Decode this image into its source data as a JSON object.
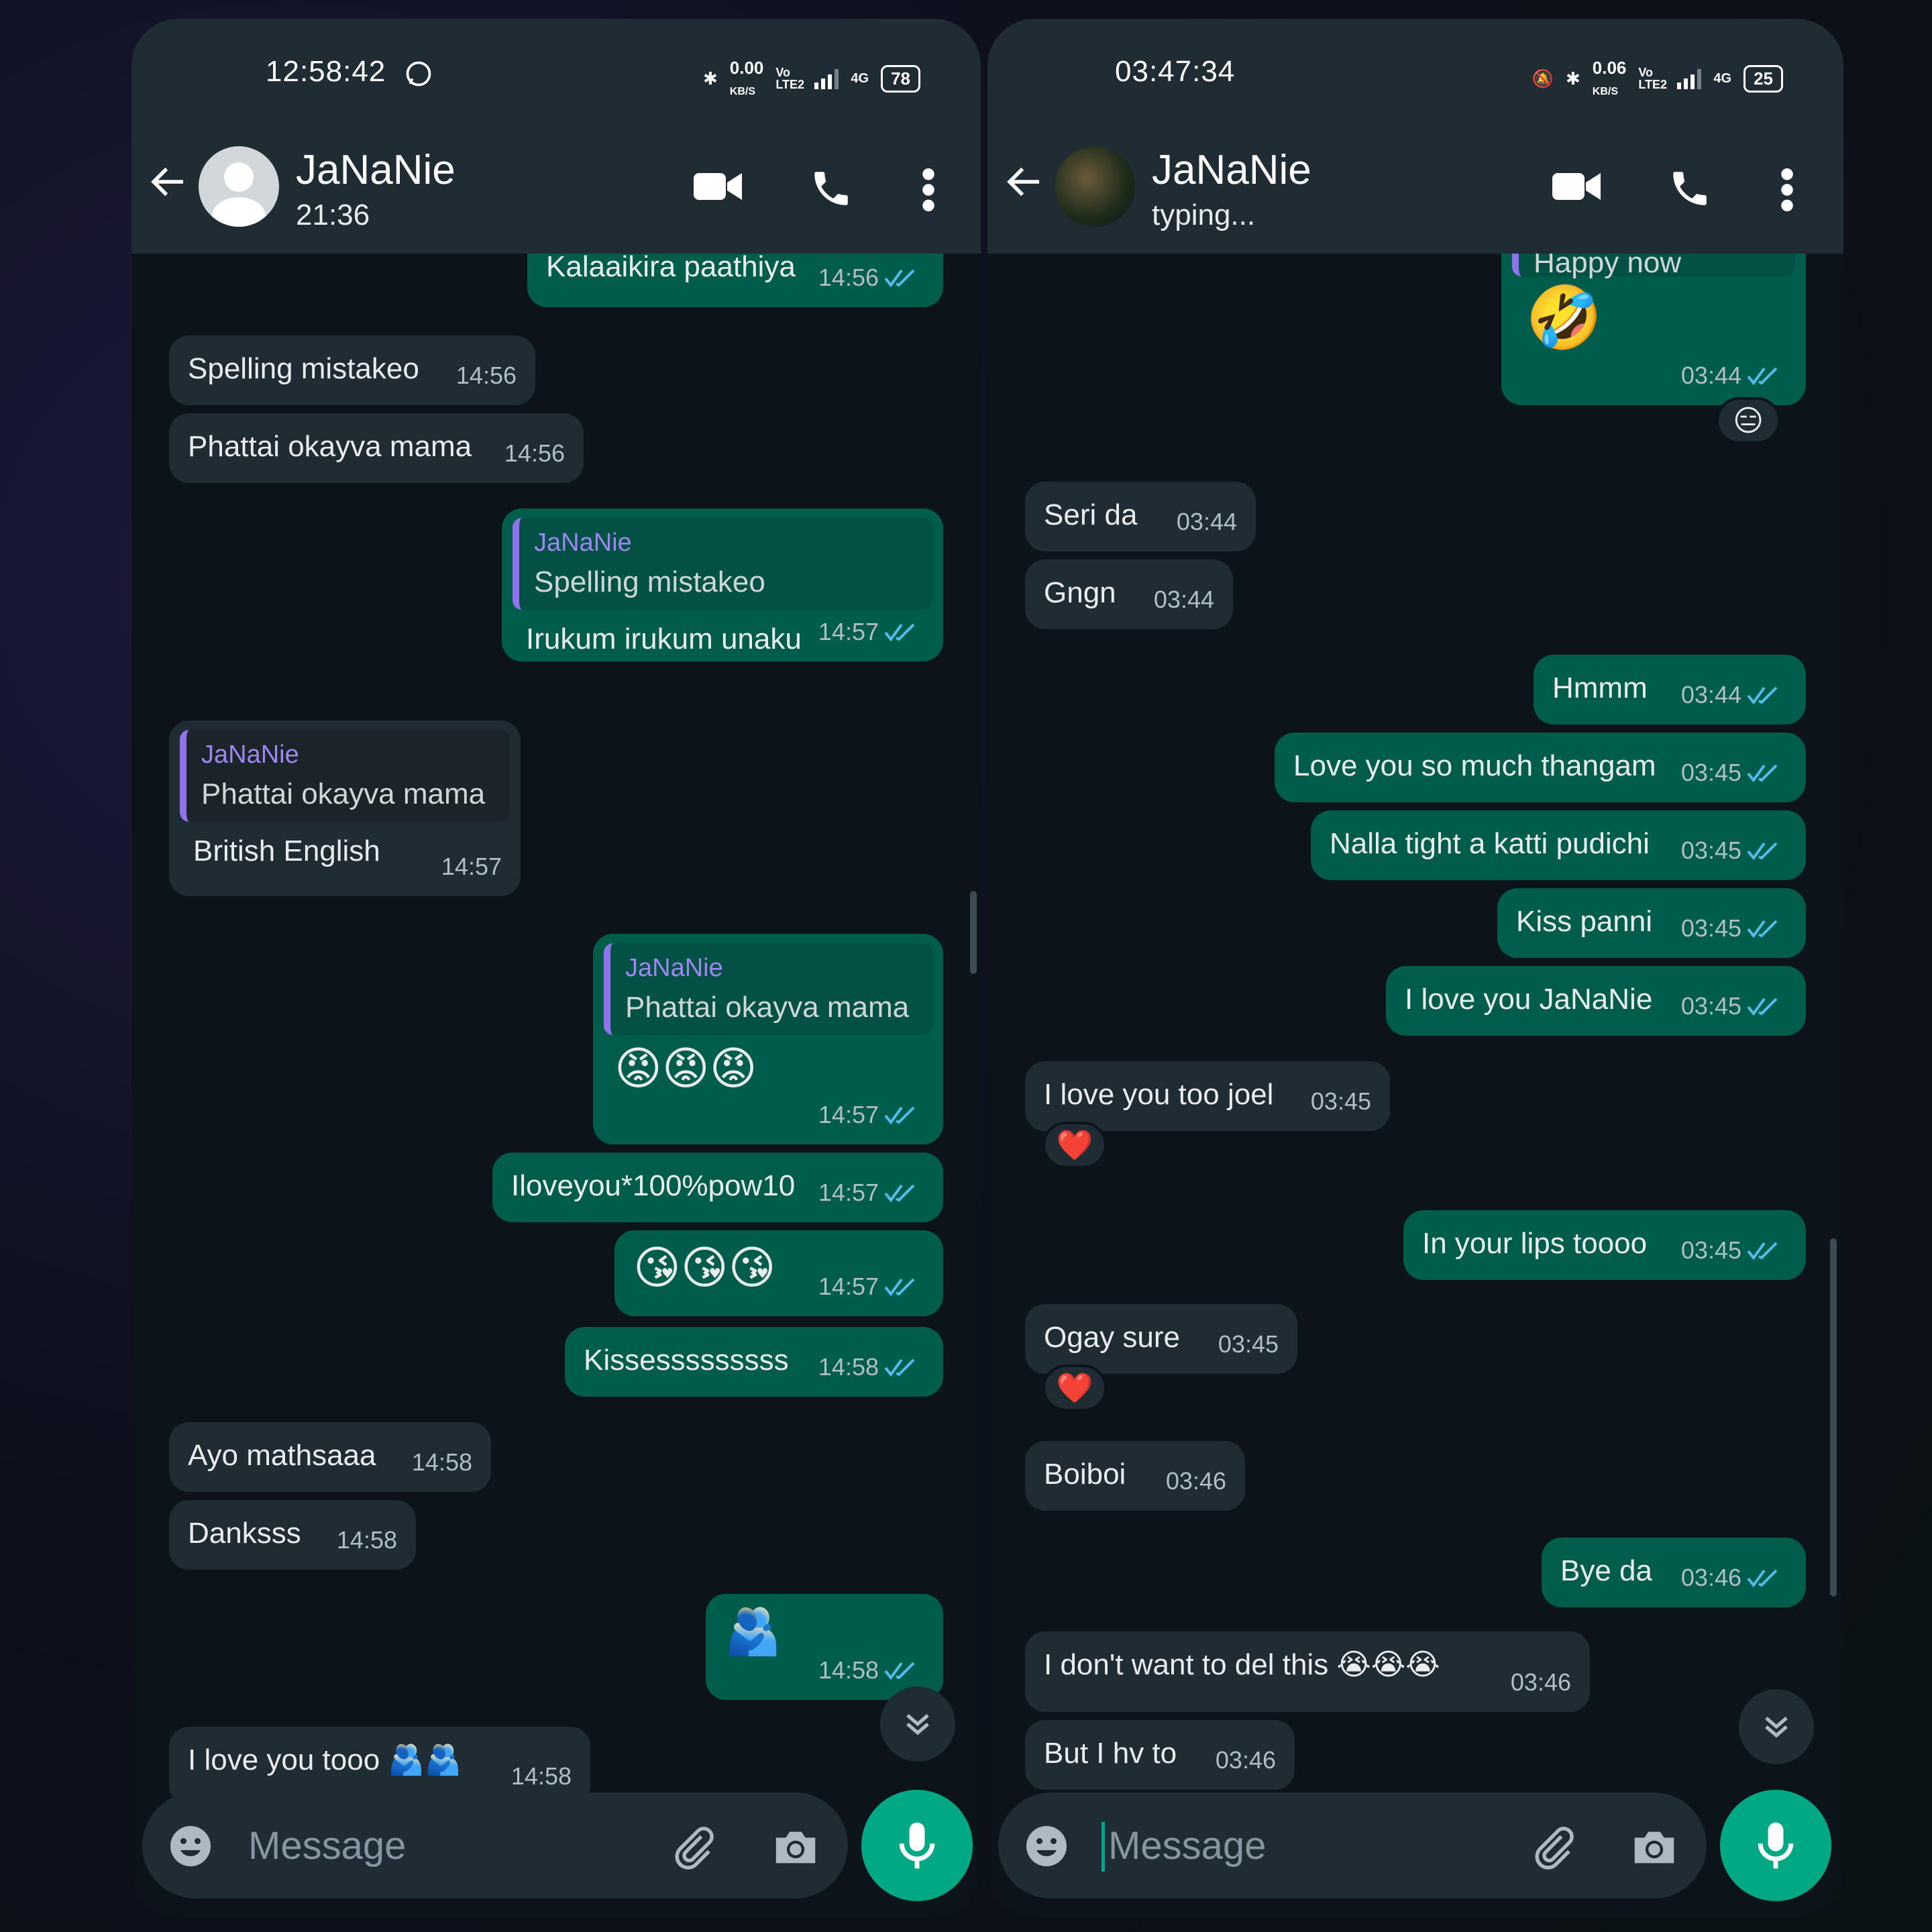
{
  "left": {
    "status": {
      "time": "12:58:42",
      "net_speed": "0.00",
      "net_unit": "KB/S",
      "volte": "Vo LTE2",
      "network": "4G",
      "battery": "78"
    },
    "header": {
      "name": "JaNaNie",
      "status": "21:36"
    },
    "messages": [
      {
        "text": "Kalaaikira paathiya",
        "time": "14:56"
      },
      {
        "text": "Spelling mistakeo",
        "time": "14:56"
      },
      {
        "text": "Phattai okayva mama",
        "time": "14:56"
      },
      {
        "quote_name": "JaNaNie",
        "quote_text": "Spelling mistakeo",
        "text": "Irukum irukum unaku",
        "time": "14:57"
      },
      {
        "quote_name": "JaNaNie",
        "quote_text": "Phattai okayva mama",
        "text": "British English",
        "time": "14:57"
      },
      {
        "quote_name": "JaNaNie",
        "quote_text": "Phattai okayva mama",
        "text": "😡😡😡",
        "time": "14:57"
      },
      {
        "text": "Iloveyou*100%pow10",
        "time": "14:57"
      },
      {
        "text": "😘😘😘",
        "time": "14:57"
      },
      {
        "text": "Kissesssssssss",
        "time": "14:58"
      },
      {
        "text": "Ayo mathsaaa",
        "time": "14:58"
      },
      {
        "text": "Danksss",
        "time": "14:58"
      },
      {
        "text": "🫂",
        "time": "14:58"
      },
      {
        "text": "I love you tooo 🫂🫂",
        "time": "14:58"
      }
    ],
    "composer": {
      "placeholder": "Message"
    }
  },
  "right": {
    "status": {
      "time": "03:47:34",
      "net_speed": "0.06",
      "net_unit": "KB/S",
      "volte": "Vo LTE2",
      "network": "4G",
      "battery": "25"
    },
    "header": {
      "name": "JaNaNie",
      "status": "typing..."
    },
    "messages": [
      {
        "quote_text": "Happy now",
        "text": "🤣",
        "time": "03:44",
        "reaction": "😑"
      },
      {
        "text": "Seri da",
        "time": "03:44"
      },
      {
        "text": "Gngn",
        "time": "03:44"
      },
      {
        "text": "Hmmm",
        "time": "03:44"
      },
      {
        "text": "Love you so much thangam",
        "time": "03:45"
      },
      {
        "text": "Nalla tight a katti pudichi",
        "time": "03:45"
      },
      {
        "text": "Kiss panni",
        "time": "03:45"
      },
      {
        "text": "I love you JaNaNie",
        "time": "03:45"
      },
      {
        "text": "I love you too joel",
        "time": "03:45",
        "reaction": "❤️"
      },
      {
        "text": "In your lips toooo",
        "time": "03:45"
      },
      {
        "text": "Ogay sure",
        "time": "03:45",
        "reaction": "❤️"
      },
      {
        "text": "Boiboi",
        "time": "03:46"
      },
      {
        "text": "Bye da",
        "time": "03:46"
      },
      {
        "text": "I don't want to del this 😭😭😭",
        "time": "03:46"
      },
      {
        "text": "But I hv to",
        "time": "03:46"
      }
    ],
    "composer": {
      "placeholder": "Message"
    }
  },
  "colors": {
    "incoming": "#202c33",
    "outgoing": "#005c4b",
    "accent": "#00a884",
    "tick_read": "#53bdeb",
    "quote_name": "#9d86f2"
  },
  "icons": [
    "back-arrow-icon",
    "video-call-icon",
    "phone-icon",
    "more-options-icon",
    "emoji-icon",
    "attach-icon",
    "camera-icon",
    "mic-icon",
    "chevron-down-double-icon",
    "double-check-icon"
  ]
}
